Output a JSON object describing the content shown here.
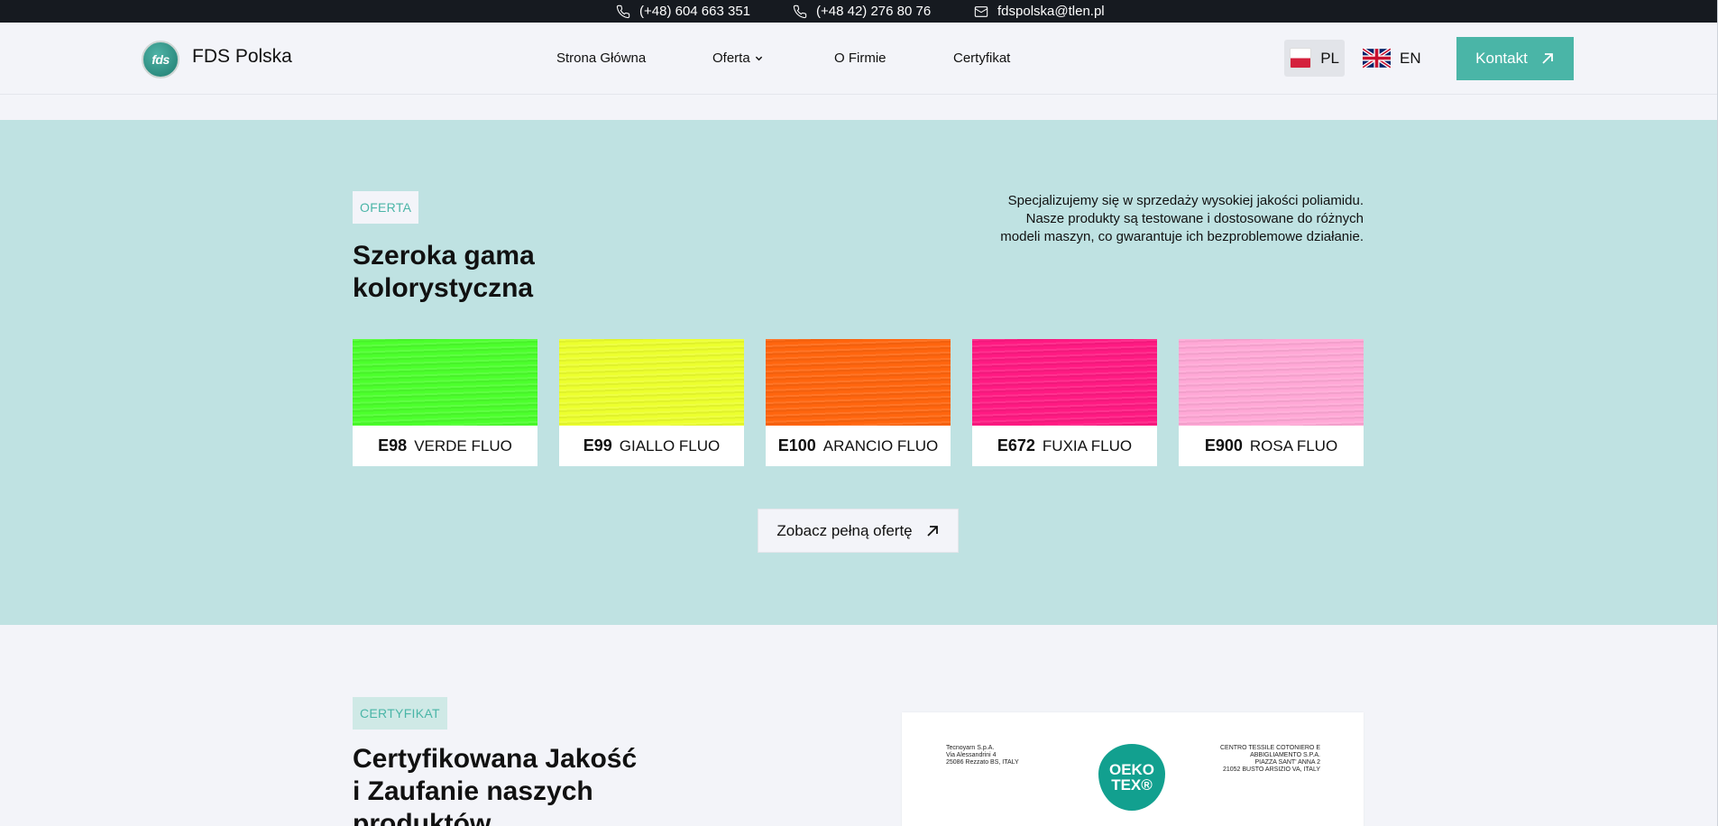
{
  "topbar": {
    "phone1": "(+48) 604 663 351",
    "phone2": "(+48 42) 276 80 76",
    "email": "fdspolska@tlen.pl"
  },
  "header": {
    "logo_text": "fds",
    "brand": "FDS Polska",
    "nav": [
      "Strona Główna",
      "Oferta",
      "O Firmie",
      "Certyfikat"
    ],
    "langs": [
      {
        "code": "PL",
        "active": true
      },
      {
        "code": "EN",
        "active": false
      }
    ],
    "cta": "Kontakt"
  },
  "offer": {
    "tag": "OFERTA",
    "title_line1": "Szeroka gama",
    "title_line2": "kolorystyczna",
    "lead": "Specjalizujemy się w sprzedaży wysokiej jakości poliamidu. Nasze produkty są testowane i dostosowane do różnych modeli maszyn, co gwarantuje ich bezproblemowe działanie.",
    "colors": [
      {
        "code": "E98",
        "name": "VERDE FLUO",
        "hex": "#4cff2c"
      },
      {
        "code": "E99",
        "name": "GIALLO FLUO",
        "hex": "#ecff2e"
      },
      {
        "code": "E100",
        "name": "ARANCIO FLUO",
        "hex": "#ff650e"
      },
      {
        "code": "E672",
        "name": "FUXIA FLUO",
        "hex": "#ff1a82"
      },
      {
        "code": "E900",
        "name": "ROSA FLUO",
        "hex": "#ffa8d6"
      }
    ],
    "more_button": "Zobacz pełną ofertę"
  },
  "certificate": {
    "tag": "CERTYFIKAT",
    "title_line1": "Certyfikowana Jakość",
    "title_line2": "i Zaufanie naszych",
    "title_line3": "produktów",
    "doc_left": [
      "Tecnoyarn S.p.A.",
      "Via Alessandrini 4",
      "25086 Rezzato BS, ITALY"
    ],
    "doc_right": [
      "CENTRO TESSILE COTONIERO E",
      "ABBIGLIAMENTO S.P.A.",
      "PIAZZA SANT' ANNA 2",
      "21052 BUSTO ARSIZIO VA, ITALY"
    ],
    "logo_line1": "OEKO",
    "logo_line2": "TEX®"
  },
  "accent_color": "#4ab5a7"
}
